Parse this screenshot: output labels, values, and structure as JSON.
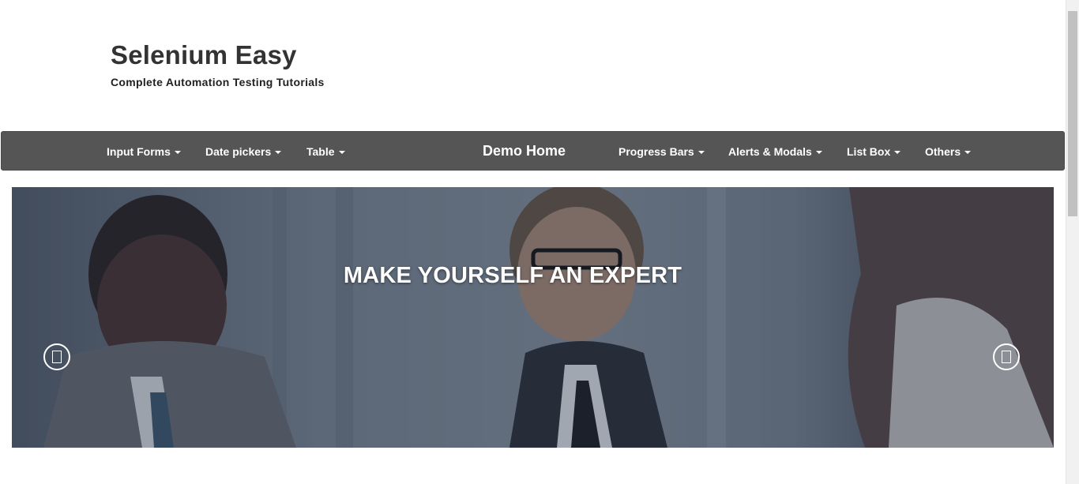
{
  "header": {
    "title": "Selenium Easy",
    "tagline": "Complete Automation Testing Tutorials"
  },
  "navbar": {
    "left_items": [
      {
        "label": "Input Forms"
      },
      {
        "label": "Date pickers"
      },
      {
        "label": "Table"
      }
    ],
    "brand": "Demo Home",
    "right_items": [
      {
        "label": "Progress Bars"
      },
      {
        "label": "Alerts & Modals"
      },
      {
        "label": "List Box"
      },
      {
        "label": "Others"
      }
    ],
    "colors": {
      "background": "#555555",
      "text": "#ffffff"
    }
  },
  "carousel": {
    "caption": "MAKE YOURSELF AN EXPERT",
    "prev_icon": "chevron-left-icon",
    "next_icon": "chevron-right-icon"
  }
}
